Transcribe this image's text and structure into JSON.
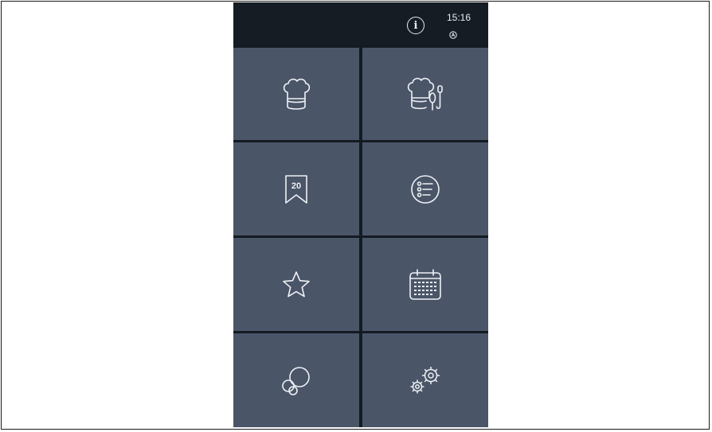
{
  "status": {
    "time": "15:16",
    "info_icon": "info-icon",
    "status_icon": "status-icon"
  },
  "tiles": [
    {
      "icon": "chef-hat-icon"
    },
    {
      "icon": "chef-hat-utensils-icon"
    },
    {
      "icon": "bookmark-20-icon",
      "label": "20"
    },
    {
      "icon": "list-icon"
    },
    {
      "icon": "star-icon"
    },
    {
      "icon": "calendar-icon"
    },
    {
      "icon": "bubbles-icon"
    },
    {
      "icon": "gears-icon"
    }
  ],
  "colors": {
    "tile_bg": "#4a5568",
    "separator": "#141a22",
    "icon_stroke": "#eef1f4"
  }
}
